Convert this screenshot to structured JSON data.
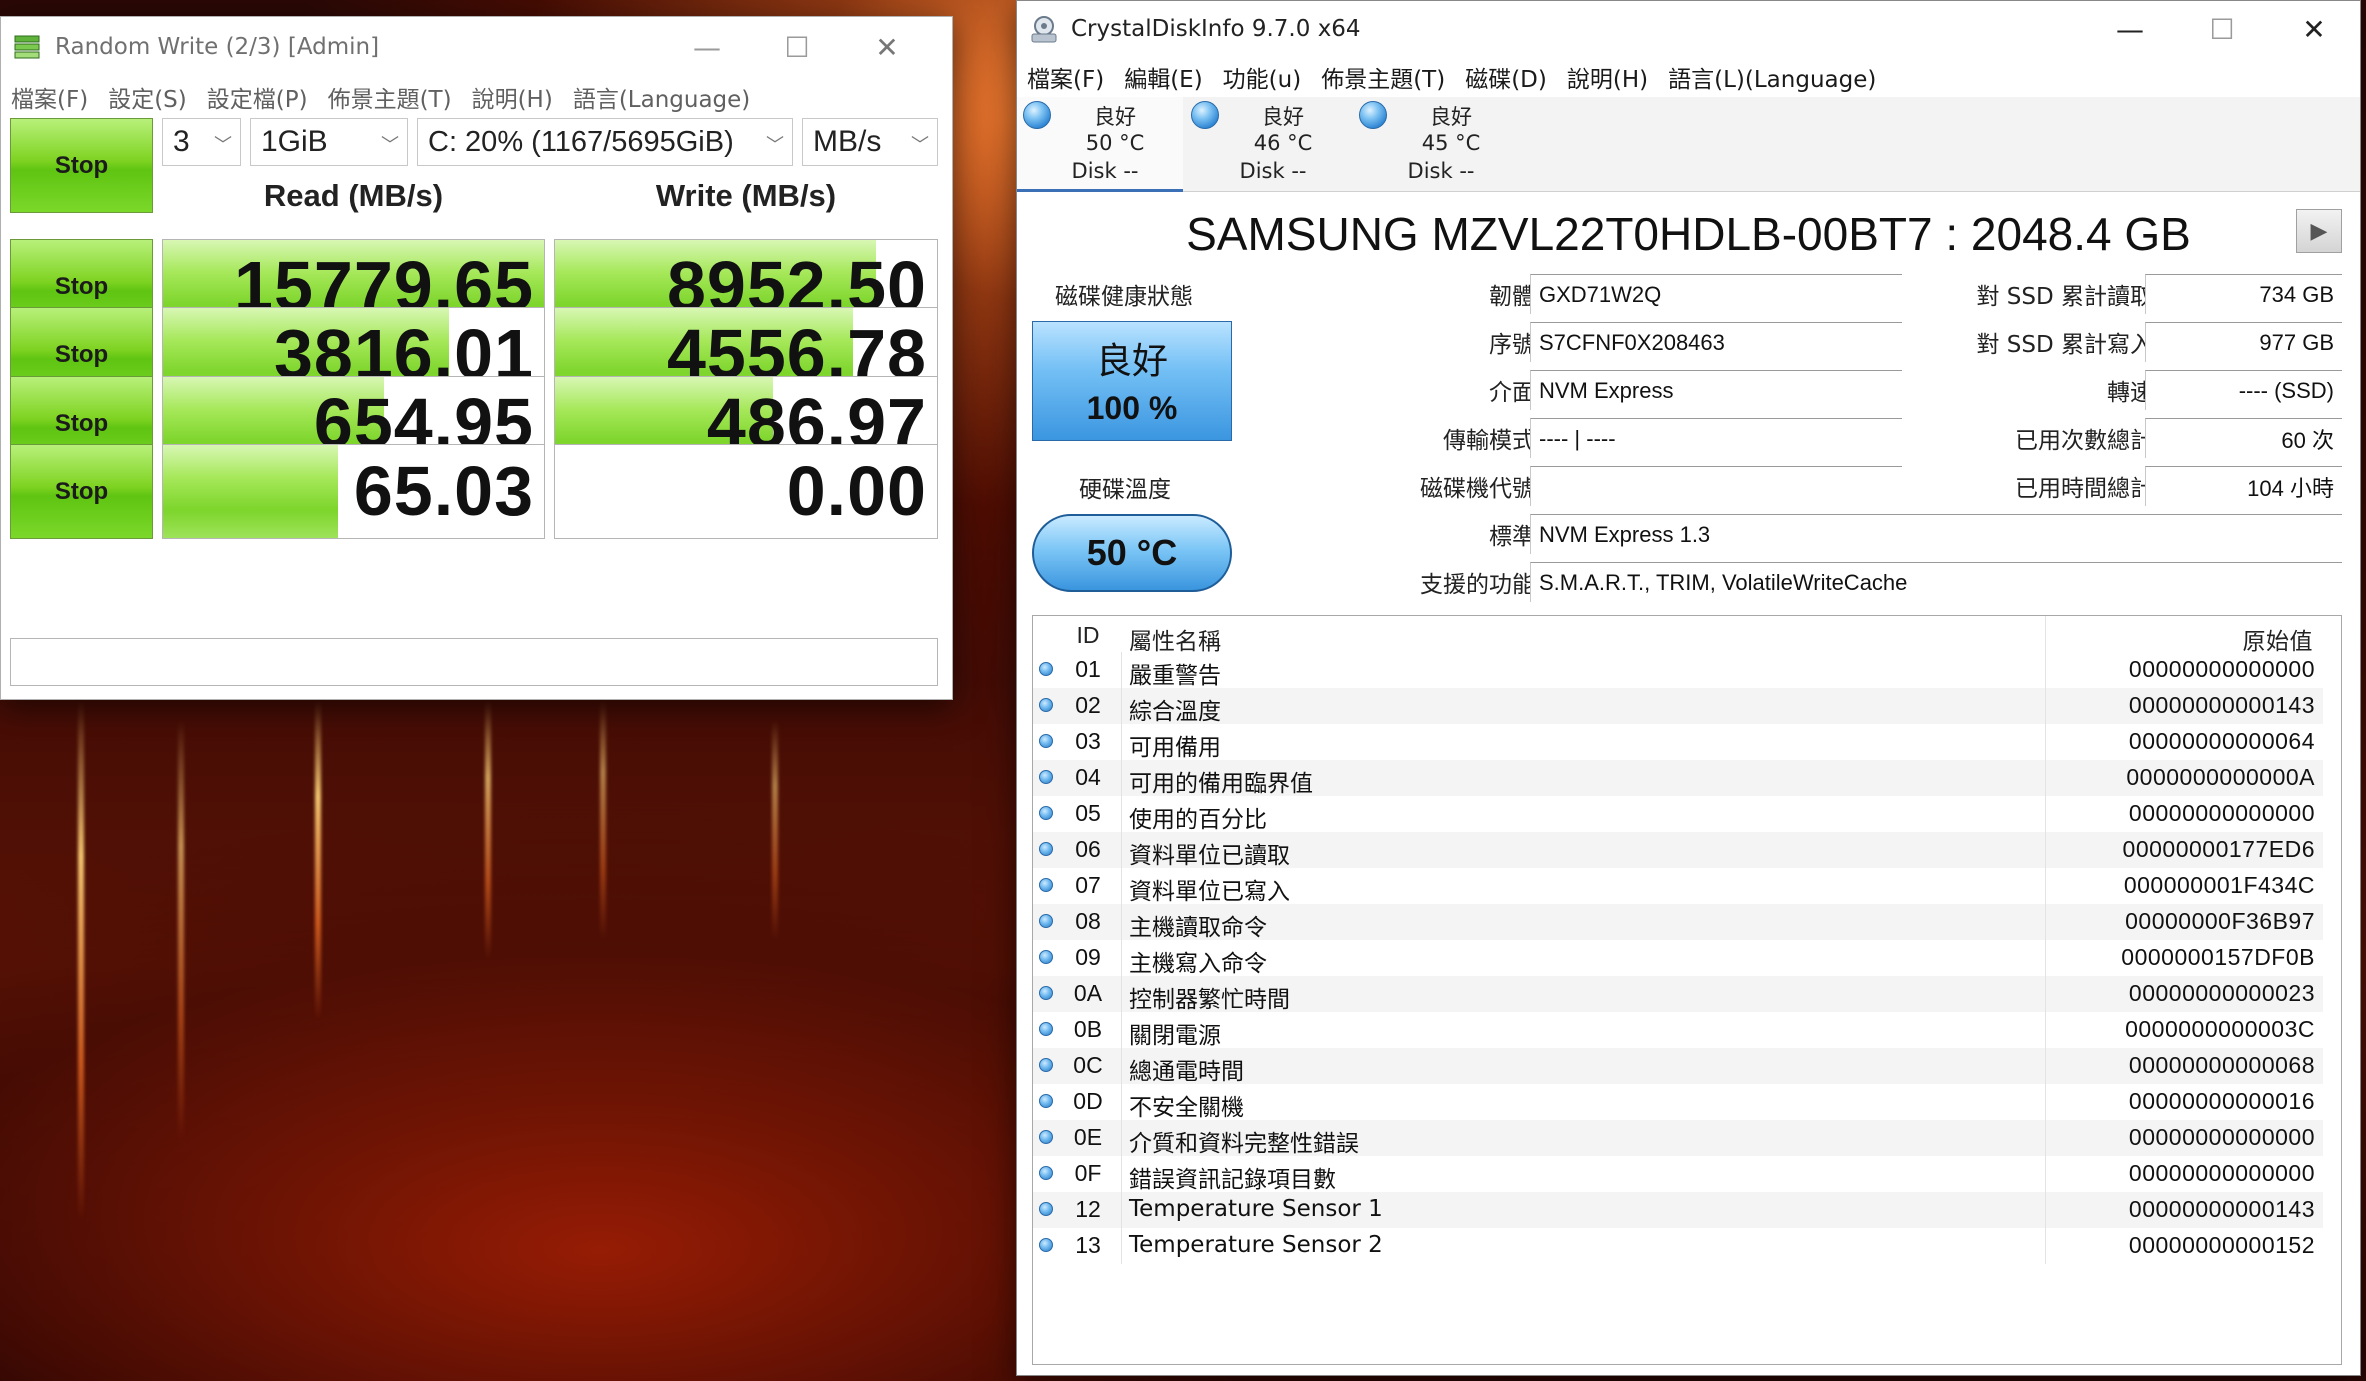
{
  "cdm": {
    "title": "Random Write (2/3) [Admin]",
    "menu": [
      "檔案(F)",
      "設定(S)",
      "設定檔(P)",
      "佈景主題(T)",
      "說明(H)",
      "語言(Language)"
    ],
    "top_button": "Stop",
    "count": "3",
    "size": "1GiB",
    "drive": "C: 20% (1167/5695GiB)",
    "unit": "MB/s",
    "read_header": "Read (MB/s)",
    "write_header": "Write (MB/s)",
    "rows": [
      {
        "button": "Stop",
        "read": "15779.65",
        "write": "8952.50",
        "read_fill": 1.0,
        "write_fill": 0.84
      },
      {
        "button": "Stop",
        "read": "3816.01",
        "write": "4556.78",
        "read_fill": 0.75,
        "write_fill": 0.78
      },
      {
        "button": "Stop",
        "read": "654.95",
        "write": "486.97",
        "read_fill": 0.58,
        "write_fill": 0.57
      },
      {
        "button": "Stop",
        "read": "65.03",
        "write": "0.00",
        "read_fill": 0.46,
        "write_fill": 0.0
      }
    ]
  },
  "cdi": {
    "title": "CrystalDiskInfo 9.7.0 x64",
    "menu": [
      "檔案(F)",
      "編輯(E)",
      "功能(u)",
      "佈景主題(T)",
      "磁碟(D)",
      "說明(H)",
      "語言(L)(Language)"
    ],
    "disks": [
      {
        "status": "良好",
        "temp": "50 °C",
        "name": "Disk --"
      },
      {
        "status": "良好",
        "temp": "46 °C",
        "name": "Disk --"
      },
      {
        "status": "良好",
        "temp": "45 °C",
        "name": "Disk --"
      }
    ],
    "model": "SAMSUNG MZVL22T0HDLB-00BT7 : 2048.4 GB",
    "health_label": "磁碟健康狀態",
    "health_status": "良好",
    "health_percent": "100 %",
    "temp_label": "硬碟溫度",
    "temp_value": "50 °C",
    "info": {
      "firmware_label": "韌體",
      "firmware": "GXD71W2Q",
      "serial_label": "序號",
      "serial": "S7CFNF0X208463",
      "interface_label": "介面",
      "interface": "NVM Express",
      "transfer_label": "傳輸模式",
      "transfer": "---- | ----",
      "drive_letter_label": "磁碟機代號",
      "drive_letter": "",
      "standard_label": "標準",
      "standard": "NVM Express 1.3",
      "features_label": "支援的功能",
      "features": "S.M.A.R.T., TRIM, VolatileWriteCache",
      "host_reads_label": "對 SSD 累計讀取",
      "host_reads": "734 GB",
      "host_writes_label": "對 SSD 累計寫入",
      "host_writes": "977 GB",
      "rotation_label": "轉速",
      "rotation": "---- (SSD)",
      "power_count_label": "已用次數總計",
      "power_count": "60 次",
      "power_hours_label": "已用時間總計",
      "power_hours": "104 小時"
    },
    "smart_headers": {
      "id": "ID",
      "name": "屬性名稱",
      "raw": "原始值"
    },
    "smart": [
      {
        "id": "01",
        "name": "嚴重警告",
        "raw": "00000000000000"
      },
      {
        "id": "02",
        "name": "綜合溫度",
        "raw": "00000000000143"
      },
      {
        "id": "03",
        "name": "可用備用",
        "raw": "00000000000064"
      },
      {
        "id": "04",
        "name": "可用的備用臨界值",
        "raw": "0000000000000A"
      },
      {
        "id": "05",
        "name": "使用的百分比",
        "raw": "00000000000000"
      },
      {
        "id": "06",
        "name": "資料單位已讀取",
        "raw": "00000000177ED6"
      },
      {
        "id": "07",
        "name": "資料單位已寫入",
        "raw": "000000001F434C"
      },
      {
        "id": "08",
        "name": "主機讀取命令",
        "raw": "00000000F36B97"
      },
      {
        "id": "09",
        "name": "主機寫入命令",
        "raw": "0000000157DF0B"
      },
      {
        "id": "0A",
        "name": "控制器繁忙時間",
        "raw": "00000000000023"
      },
      {
        "id": "0B",
        "name": "關閉電源",
        "raw": "0000000000003C"
      },
      {
        "id": "0C",
        "name": "總通電時間",
        "raw": "00000000000068"
      },
      {
        "id": "0D",
        "name": "不安全關機",
        "raw": "00000000000016"
      },
      {
        "id": "0E",
        "name": "介質和資料完整性錯誤",
        "raw": "00000000000000"
      },
      {
        "id": "0F",
        "name": "錯誤資訊記錄項目數",
        "raw": "00000000000000"
      },
      {
        "id": "12",
        "name": "Temperature Sensor 1",
        "raw": "00000000000143"
      },
      {
        "id": "13",
        "name": "Temperature Sensor 2",
        "raw": "00000000000152"
      }
    ]
  }
}
